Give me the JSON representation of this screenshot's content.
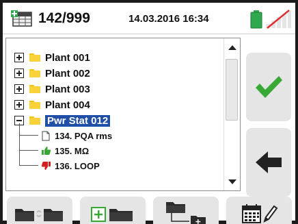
{
  "status": {
    "memory_count": "142/999",
    "datetime": "14.03.2016  16:34",
    "battery_color": "#2fa84f",
    "signal_state": "disconnected"
  },
  "tree": {
    "items": [
      {
        "label": "Plant 001",
        "expander": "plus",
        "icon": "folder-icon"
      },
      {
        "label": "Plant 002",
        "expander": "plus",
        "icon": "folder-icon"
      },
      {
        "label": "Plant 003",
        "expander": "plus",
        "icon": "folder-icon"
      },
      {
        "label": "Plant 004",
        "expander": "plus",
        "icon": "folder-icon"
      },
      {
        "label": "Pwr Stat 012",
        "expander": "minus",
        "icon": "folder-icon",
        "selected": true
      }
    ],
    "children": [
      {
        "label": "134. PQA rms",
        "icon": "document-icon"
      },
      {
        "label": "135. MΩ",
        "icon": "thumbs-up-icon",
        "icon_color": "#3aa635"
      },
      {
        "label": "136. LOOP",
        "icon": "thumbs-down-icon",
        "icon_color": "#d21f1f"
      }
    ]
  },
  "side_buttons": {
    "ok_icon": "checkmark-icon",
    "ok_color": "#38a935",
    "back_icon": "arrow-left-icon"
  },
  "toolbar": {
    "buttons": [
      {
        "name": "move-folder-button",
        "icon": "folder-transfer-icon"
      },
      {
        "name": "new-folder-button",
        "icon": "add-folder-icon"
      },
      {
        "name": "new-subfolder-button",
        "icon": "add-subfolder-icon"
      },
      {
        "name": "edit-date-button",
        "icon": "calendar-edit-icon"
      }
    ]
  }
}
